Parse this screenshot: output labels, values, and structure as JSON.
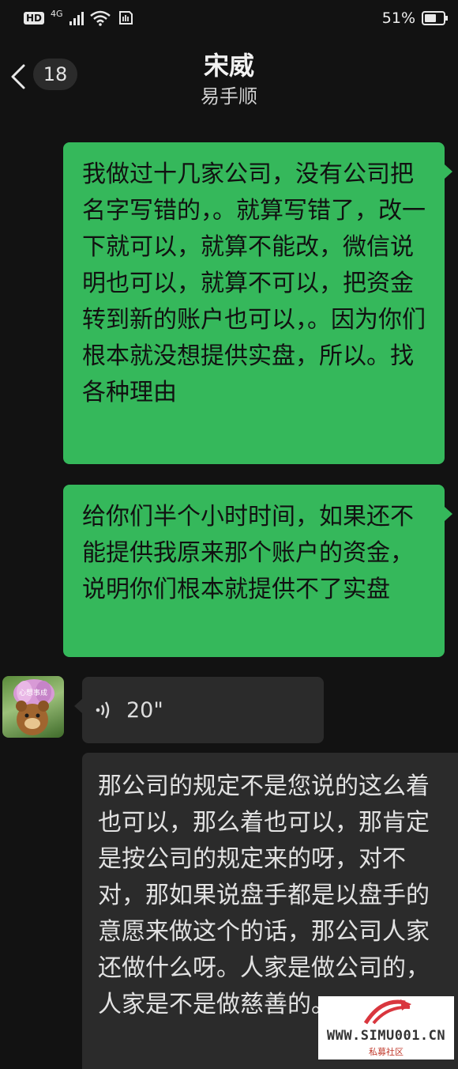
{
  "status_bar": {
    "hd": "HD",
    "network": "4G",
    "battery_percent": "51%"
  },
  "nav": {
    "unread_count": "18",
    "title": "宋威",
    "subtitle": "易手顺"
  },
  "messages": [
    {
      "sender": "me",
      "text": "我做过十几家公司，没有公司把名字写错的，。就算写错了，改一下就可以，就算不能改，微信说明也可以，就算不可以，把资金转到新的账户也可以，。因为你们根本就没想提供实盘，所以。找各种理由"
    },
    {
      "sender": "me",
      "text": "给你们半个小时时间，如果还不能提供我原来那个账户的资金，说明你们根本就提供不了实盘"
    },
    {
      "sender": "other",
      "type": "voice",
      "duration": "20\""
    },
    {
      "sender": "other",
      "text": "那公司的规定不是您说的这么着也可以，那么着也可以，那肯定是按公司的规定来的呀，对不对，那如果说盘手都是以盘手的意愿来做这个的话，那公司人家还做什么呀。人家是做公司的，人家是不是做慈善的。"
    }
  ],
  "avatar": {
    "text": "心想事成"
  },
  "watermark": {
    "url": "WWW.SIMU001.CN",
    "label": "私募社区"
  },
  "colors": {
    "sent_bubble": "#35b85b",
    "received_bubble": "#2b2b2b",
    "background": "#121212"
  }
}
